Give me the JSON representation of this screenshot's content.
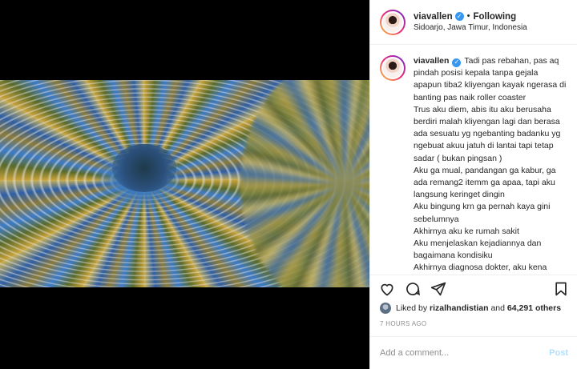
{
  "post": {
    "username": "viavallen",
    "follow_status": "Following",
    "separator": "•",
    "location": "Sidoarjo, Jawa Timur, Indonesia",
    "verified_icon": "verified-badge-icon"
  },
  "caption": {
    "username": "viavallen",
    "lines": [
      "Tadi pas rebahan, pas aq pindah posisi kepala tanpa gejala apapun tiba2 kliyengan kayak ngerasa di banting pas naik roller coaster",
      "Trus aku diem, abis itu aku berusaha berdiri malah kliyengan lagi dan berasa ada sesuatu yg ngebanting badanku yg ngebuat akuu jatuh di lantai tapi tetap sadar ( bukan pingsan )",
      "Aku ga mual, pandangan ga kabur, ga ada remang2 itemm ga apaa, tapi aku langsung keringet dingin",
      "Aku bingung krn ga pernah kaya gini sebelumnya",
      "Akhirnya aku ke rumah sakit",
      "Aku menjelaskan kejadiannya dan bagaimana kondisiku",
      "Akhirnya diagnosa dokter, aku kena"
    ]
  },
  "actions": {
    "like_icon": "heart-icon",
    "comment_icon": "comment-icon",
    "share_icon": "share-icon",
    "save_icon": "bookmark-icon"
  },
  "likes": {
    "prefix": "Liked by",
    "first_user": "rizalhandistian",
    "conjunction": "and",
    "others": "64,291 others"
  },
  "timestamp": "7 HOURS AGO",
  "comment": {
    "placeholder": "Add a comment...",
    "post_label": "Post"
  },
  "colors": {
    "accent": "#3897f0",
    "post_disabled": "#b2dffc",
    "muted": "#8e8e8e"
  }
}
